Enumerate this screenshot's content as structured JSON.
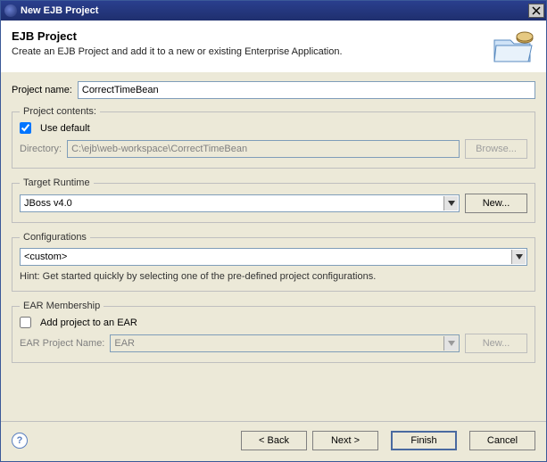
{
  "window": {
    "title": "New EJB Project"
  },
  "banner": {
    "heading": "EJB Project",
    "subtitle": "Create an EJB Project and add it to a new or existing Enterprise Application."
  },
  "project_name": {
    "label": "Project name:",
    "value": "CorrectTimeBean"
  },
  "project_contents": {
    "legend": "Project contents:",
    "use_default_label": "Use default",
    "use_default_checked": true,
    "directory_label": "Directory:",
    "directory_value": "C:\\ejb\\web-workspace\\CorrectTimeBean",
    "browse_label": "Browse..."
  },
  "target_runtime": {
    "legend": "Target Runtime",
    "value": "JBoss v4.0",
    "new_label": "New..."
  },
  "configurations": {
    "legend": "Configurations",
    "value": "<custom>",
    "hint": "Hint: Get started quickly by selecting one of the pre-defined project configurations."
  },
  "ear": {
    "legend": "EAR Membership",
    "add_label": "Add project to an EAR",
    "add_checked": false,
    "project_name_label": "EAR Project Name:",
    "project_name_value": "EAR",
    "new_label": "New..."
  },
  "footer": {
    "back": "< Back",
    "next": "Next >",
    "finish": "Finish",
    "cancel": "Cancel"
  }
}
